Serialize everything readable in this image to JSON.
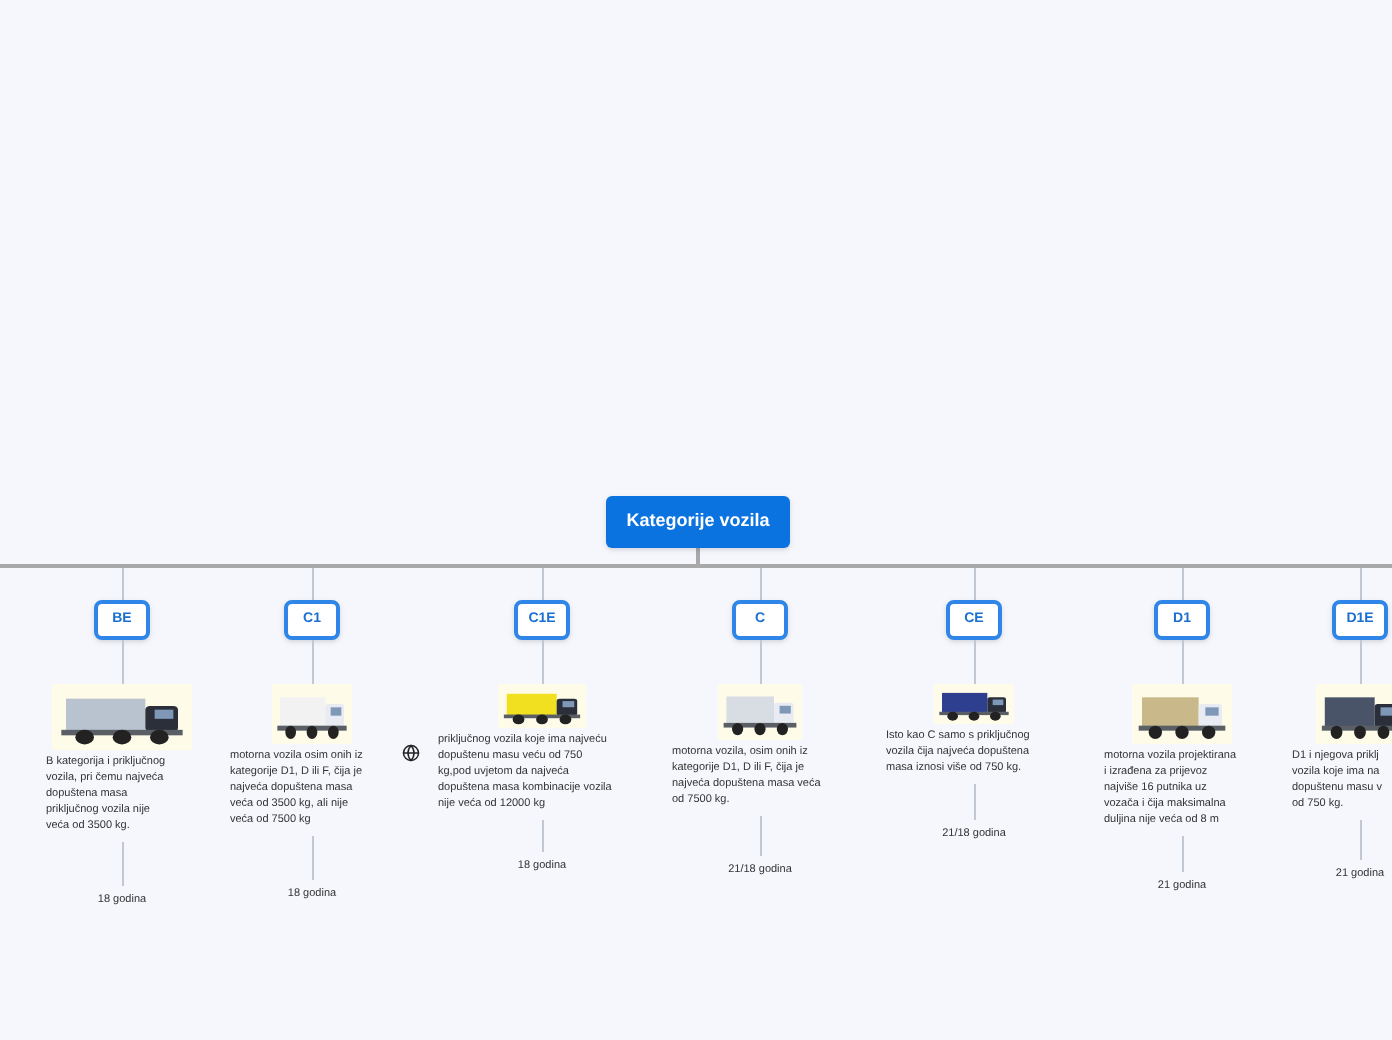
{
  "root": {
    "title": "Kategorije vozila"
  },
  "categories": [
    {
      "label": "BE",
      "description": [
        "B kategorija  i priključnog",
        "vozila, pri čemu najveća",
        "dopuštena masa",
        "priključnog vozila nije",
        "veća od 3500 kg."
      ],
      "age": "18 godina"
    },
    {
      "label": "C1",
      "description": [
        "motorna vozila osim onih iz",
        "kategorije D1, D ili F, čija je",
        "najveća dopuštena masa",
        "veća od 3500 kg, ali nije",
        "veća od 7500 kg"
      ],
      "age": "18 godina"
    },
    {
      "label": "C1E",
      "link": true,
      "description": [
        "priključnog vozila koje ima najveću",
        "dopuštenu masu veću od 750",
        "kg,pod uvjetom da najveća",
        "dopuštena masa kombinacije vozila",
        "nije veća od 12000 kg"
      ],
      "age": "18 godina"
    },
    {
      "label": "C",
      "description": [
        "motorna vozila, osim onih iz",
        "kategorije D1, D ili F, čija je",
        "najveća dopuštena masa veća",
        "od 7500 kg."
      ],
      "age": "21/18 godina"
    },
    {
      "label": "CE",
      "description": [
        "Isto kao C samo s priključnog",
        "vozila čija najveća dopuštena",
        "masa iznosi više od 750 kg."
      ],
      "age": "21/18 godina"
    },
    {
      "label": "D1",
      "description": [
        "motorna vozila projektirana",
        "i izrađena za prijevoz",
        "najviše 16 putnika uz",
        "vozača i čija maksimalna",
        "duljina nije veća od 8 m"
      ],
      "age": "21 godina"
    },
    {
      "label": "D1E",
      "description": [
        "D1 i njegova priklj",
        "vozila koje ima na",
        "dopuštenu masu v",
        "od 750 kg."
      ],
      "age": "21 godina"
    }
  ]
}
